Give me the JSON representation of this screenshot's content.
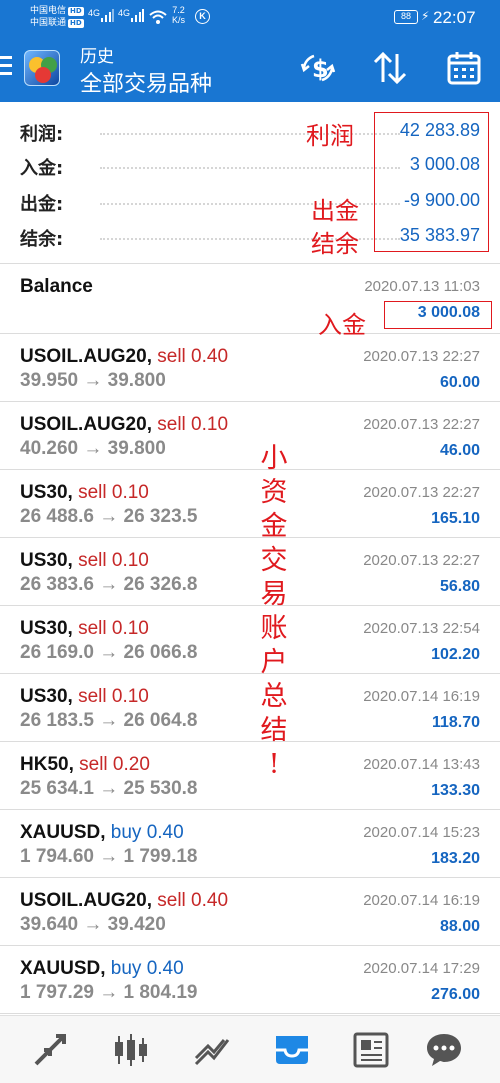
{
  "status_bar": {
    "carrier1": "中国电信",
    "carrier2": "中国联通",
    "hd": "HD",
    "signal1": "4G",
    "signal2": "4G",
    "net_speed": "7.2",
    "net_unit": "K/s",
    "k_badge": "K",
    "battery": "88",
    "time": "22:07"
  },
  "app_bar": {
    "title": "历史",
    "subtitle": "全部交易品种"
  },
  "summary": [
    {
      "label": "利润:",
      "value": "42 283.89"
    },
    {
      "label": "入金:",
      "value": "3 000.08"
    },
    {
      "label": "出金:",
      "value": "-9 900.00"
    },
    {
      "label": "结余:",
      "value": "35 383.97"
    }
  ],
  "balance": {
    "label": "Balance",
    "time": "2020.07.13 11:03",
    "value": "3 000.08"
  },
  "records": [
    {
      "symbol": "USOIL.AUG20,",
      "type": "sell 0.40",
      "side": "sell",
      "prices": "39.950 → 39.800",
      "time": "2020.07.13 22:27",
      "profit": "60.00"
    },
    {
      "symbol": "USOIL.AUG20,",
      "type": "sell 0.10",
      "side": "sell",
      "prices": "40.260 → 39.800",
      "time": "2020.07.13 22:27",
      "profit": "46.00"
    },
    {
      "symbol": "US30,",
      "type": "sell 0.10",
      "side": "sell",
      "prices": "26 488.6 → 26 323.5",
      "time": "2020.07.13 22:27",
      "profit": "165.10"
    },
    {
      "symbol": "US30,",
      "type": "sell 0.10",
      "side": "sell",
      "prices": "26 383.6 → 26 326.8",
      "time": "2020.07.13 22:27",
      "profit": "56.80"
    },
    {
      "symbol": "US30,",
      "type": "sell 0.10",
      "side": "sell",
      "prices": "26 169.0 → 26 066.8",
      "time": "2020.07.13 22:54",
      "profit": "102.20"
    },
    {
      "symbol": "US30,",
      "type": "sell 0.10",
      "side": "sell",
      "prices": "26 183.5 → 26 064.8",
      "time": "2020.07.14 16:19",
      "profit": "118.70"
    },
    {
      "symbol": "HK50,",
      "type": "sell 0.20",
      "side": "sell",
      "prices": "25 634.1 → 25 530.8",
      "time": "2020.07.14 13:43",
      "profit": "133.30"
    },
    {
      "symbol": "XAUUSD,",
      "type": "buy 0.40",
      "side": "buy",
      "prices": "1 794.60 → 1 799.18",
      "time": "2020.07.14 15:23",
      "profit": "183.20"
    },
    {
      "symbol": "USOIL.AUG20,",
      "type": "sell 0.40",
      "side": "sell",
      "prices": "39.640 → 39.420",
      "time": "2020.07.14 16:19",
      "profit": "88.00"
    },
    {
      "symbol": "XAUUSD,",
      "type": "buy 0.40",
      "side": "buy",
      "prices": "1 797.29 → 1 804.19",
      "time": "2020.07.14 17:29",
      "profit": "276.00"
    }
  ],
  "annotations": {
    "profit": "利润",
    "withdraw": "出金",
    "balance": "结余",
    "deposit": "入金",
    "vertical": [
      "小",
      "资",
      "金",
      "交",
      "易",
      "账",
      "户",
      "总",
      "结",
      "!"
    ]
  },
  "colors": {
    "primary": "#1976d2",
    "value_blue": "#1565c0",
    "sell_red": "#c62828",
    "annotation_red": "#e0191e",
    "active_nav": "#1e88e5"
  },
  "icons": {
    "menu": "hamburger-menu-icon",
    "app_logo": "metatrader-logo-icon",
    "deposit": "dollar-sync-icon",
    "sort": "sort-arrows-icon",
    "calendar": "calendar-icon",
    "nav": [
      "quotes-icon",
      "chart-candles-icon",
      "trade-icon",
      "history-icon",
      "news-icon",
      "chat-icon"
    ]
  }
}
